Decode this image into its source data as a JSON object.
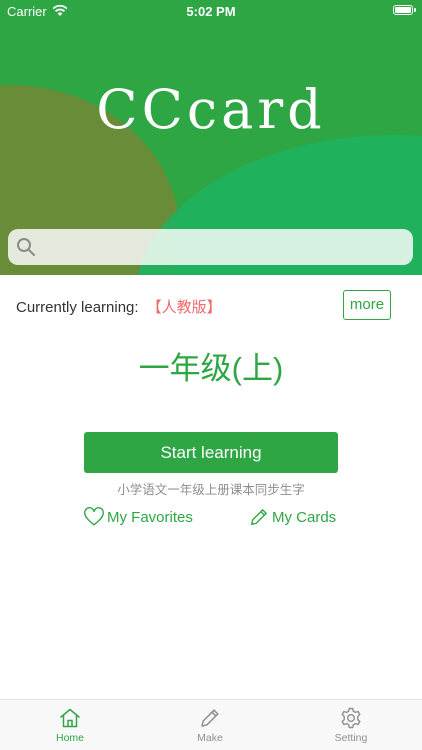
{
  "status_bar": {
    "carrier": "Carrier",
    "time": "5:02 PM"
  },
  "header": {
    "app_title": "CCcard",
    "search_placeholder": ""
  },
  "learning": {
    "label": "Currently learning:",
    "edition": "【人教版】",
    "more_label": "more",
    "grade_title": "一年级(上)",
    "start_label": "Start learning",
    "description": "小学语文一年级上册课本同步生字"
  },
  "links": {
    "favorites": "My Favorites",
    "cards": "My Cards"
  },
  "tab_bar": {
    "items": [
      {
        "label": "Home",
        "icon": "home-icon",
        "active": true
      },
      {
        "label": "Make",
        "icon": "pencil-icon",
        "active": false
      },
      {
        "label": "Setting",
        "icon": "gear-icon",
        "active": false
      }
    ]
  },
  "colors": {
    "brand_green": "#2ea644",
    "edition_red": "#ef6a6a",
    "muted_gray": "#8e8e8e"
  }
}
